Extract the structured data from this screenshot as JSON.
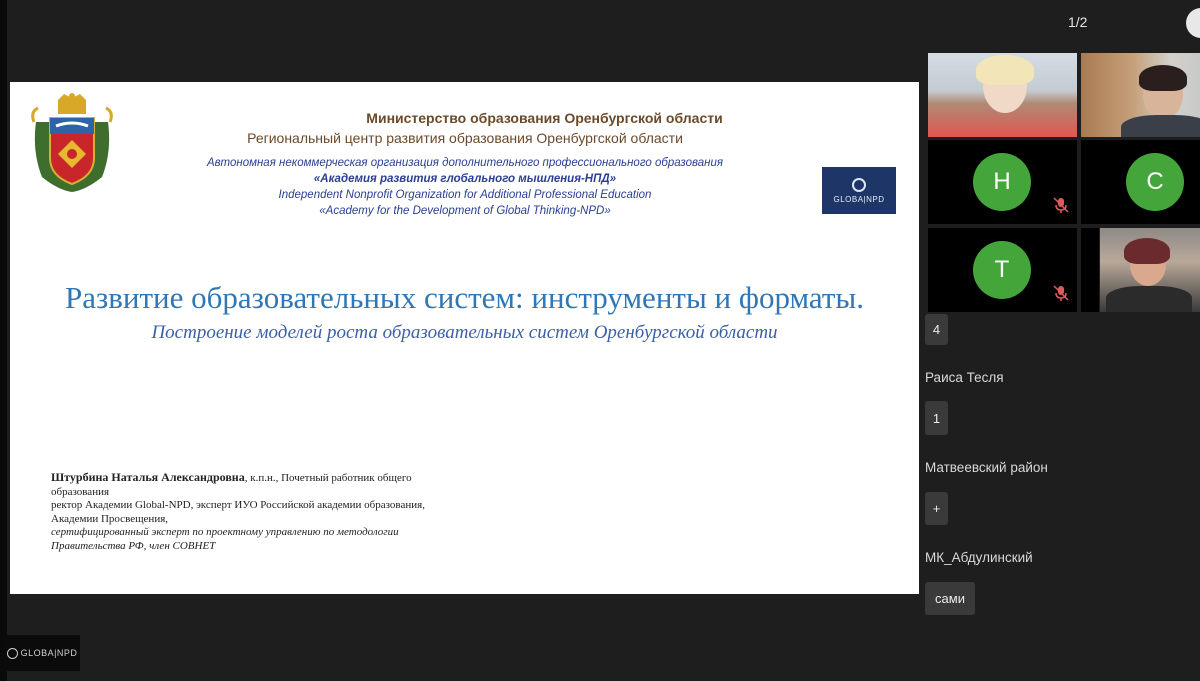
{
  "page_indicator": "1/2",
  "slide": {
    "ministry": "Министерство образования Оренбургской области",
    "center": "Региональный центр развития образования Оренбургской области",
    "org_line1": "Автономная некоммерческая организация дополнительного профессионального образования",
    "org_line2": "«Академия развития глобального мышления-НПД»",
    "org_line3": "Independent Nonprofit Organization for Additional Professional Education",
    "org_line4": "«Academy for the Development of Global Thinking-NPD»",
    "logo_text": "GLOBA|NPD",
    "title": "Развитие образовательных систем: инструменты и форматы.",
    "subtitle": "Построение моделей роста образовательных систем Оренбургской области",
    "bio": {
      "name": "Штурбина Наталья Александровна",
      "line1_rest": ", к.п.н., Почетный работник общего",
      "line2": "образования",
      "line3": "ректор Академии Global-NPD, эксперт ИУО Российской академии образования,",
      "line4": "Академии Просвещения,",
      "line5": "сертифицированный эксперт по проектному управлению по методологии",
      "line6": "Правительства РФ, член СОВНЕТ"
    }
  },
  "participants": [
    {
      "initial": "Н",
      "muted": true
    },
    {
      "initial": "С",
      "muted": false
    },
    {
      "initial": "Т",
      "muted": true
    }
  ],
  "chat": [
    {
      "name": "",
      "message": "4"
    },
    {
      "name": "Раиса Тесля",
      "message": "1"
    },
    {
      "name": "Матвеевский район",
      "message": "+"
    },
    {
      "name": "МК_Абдулинский",
      "message": "сами"
    }
  ],
  "bottom_logo_text": "GLOBA|NPD",
  "colors": {
    "avatar_green": "#44a63a",
    "slide_title": "#2f77b6",
    "header_brown": "#6b4a2b",
    "org_blue": "#2a3f8f"
  }
}
